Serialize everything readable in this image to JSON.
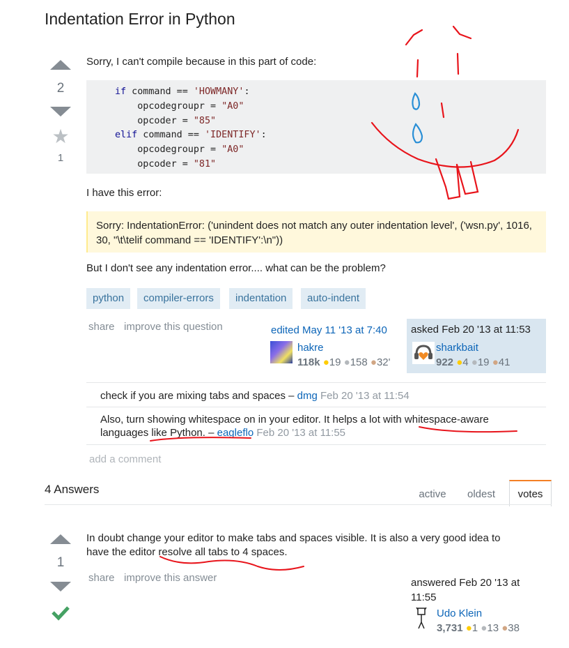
{
  "question": {
    "title": "Indentation Error in Python",
    "votes": "2",
    "favorites": "1",
    "intro": "Sorry, I can't compile because in this part of code:",
    "error_intro": "I have this error:",
    "error_text": "Sorry: IndentationError: ('unindent does not match any outer indentation level', ('wsn.py', 1016, 30, \"\\t\\telif command == 'IDENTIFY':\\n\"))",
    "closing": "But I don't see any indentation error.... what can be the problem?",
    "tags": [
      "python",
      "compiler-errors",
      "indentation",
      "auto-indent"
    ],
    "menu": {
      "share": "share",
      "improve": "improve this question"
    },
    "editor": {
      "action": "edited May 11 '13 at 7:40",
      "name": "hakre",
      "rep": "118k",
      "gold": "19",
      "silver": "158",
      "bronze": "32'"
    },
    "asker": {
      "action": "asked Feb 20 '13 at 11:53",
      "name": "sharkbait",
      "rep": "922",
      "gold": "4",
      "silver": "19",
      "bronze": "41"
    }
  },
  "code_lines": [
    {
      "kw": "if",
      "rest": " command == ",
      "str": "'HOWMANY'",
      "tail": ":"
    },
    {
      "kw": "",
      "rest": "    opcodegroupr = ",
      "str": "\"A0\"",
      "tail": ""
    },
    {
      "kw": "",
      "rest": "    opcoder = ",
      "str": "\"85\"",
      "tail": ""
    },
    {
      "kw": "elif",
      "rest": " command == ",
      "str": "'IDENTIFY'",
      "tail": ":"
    },
    {
      "kw": "",
      "rest": "    opcodegroupr = ",
      "str": "\"A0\"",
      "tail": ""
    },
    {
      "kw": "",
      "rest": "    opcoder = ",
      "str": "\"81\"",
      "tail": ""
    }
  ],
  "comments": [
    {
      "text": "check if you are mixing tabs and spaces –",
      "user": "dmg",
      "date": "Feb 20 '13 at 11:54"
    },
    {
      "text1": "Also, turn showing whitespace on in your editor. It helps a lot with whitespace-aware",
      "text2": "languages like Python. –",
      "user": "eagleflo",
      "date": "Feb 20 '13 at 11:55"
    }
  ],
  "add_comment": "add a comment",
  "answers_header": {
    "count": "4 Answers",
    "tabs": [
      "active",
      "oldest",
      "votes"
    ]
  },
  "answer": {
    "votes": "1",
    "line1": "In doubt change your editor to make tabs and spaces visible. It is also a very good idea to",
    "line2": "have the editor resolve all tabs to 4 spaces.",
    "menu": {
      "share": "share",
      "improve": "improve this answer"
    },
    "action1": "answered Feb 20 '13 at",
    "action2": "11:55",
    "name": "Udo Klein",
    "rep": "3,731",
    "gold": "1",
    "silver": "13",
    "bronze": "38"
  },
  "icons": {
    "vote_up": "up-arrow-icon",
    "vote_down": "down-arrow-icon",
    "favorite": "star-icon",
    "accepted": "checkmark-icon",
    "badge_dot": "•"
  },
  "colors": {
    "link": "#0c65b8",
    "tag_bg": "#e1ecf4",
    "tag_text": "#39739d",
    "accepted": "#45a163",
    "annotation": "#e8141b",
    "tear": "#2a8fd6"
  }
}
